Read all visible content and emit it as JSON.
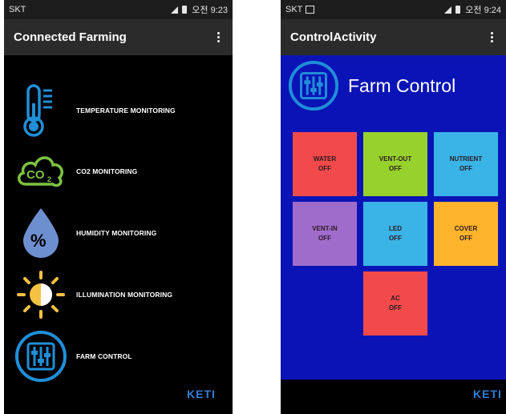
{
  "left": {
    "status": {
      "carrier": "SKT",
      "time": "오전 9:23"
    },
    "appbar_title": "Connected Farming",
    "items": [
      {
        "label": "TEMPERATURE MONITORING",
        "icon": "thermometer-icon"
      },
      {
        "label": "CO2 MONITORING",
        "icon": "co2-cloud-icon"
      },
      {
        "label": "HUMIDITY MONITORING",
        "icon": "humidity-drop-icon"
      },
      {
        "label": "ILLUMINATION MONITORING",
        "icon": "sun-icon"
      },
      {
        "label": "FARM CONTROL",
        "icon": "sliders-icon"
      }
    ],
    "logo": "KETI"
  },
  "right": {
    "status": {
      "carrier": "SKT",
      "time": "오전 9:24"
    },
    "appbar_title": "ControlActivity",
    "header_title": "Farm Control",
    "tiles": [
      {
        "name": "WATER",
        "state": "OFF",
        "color": "#f24a4a"
      },
      {
        "name": "VENT-OUT",
        "state": "OFF",
        "color": "#97d22c"
      },
      {
        "name": "NUTRIENT",
        "state": "OFF",
        "color": "#3ab3e6"
      },
      {
        "name": "VENT-IN",
        "state": "OFF",
        "color": "#a06ccc"
      },
      {
        "name": "LED",
        "state": "OFF",
        "color": "#3ab3e6"
      },
      {
        "name": "COVER",
        "state": "OFF",
        "color": "#ffb32c"
      },
      {
        "name": "AC",
        "state": "OFF",
        "color": "#f24a4a"
      }
    ],
    "logo": "KETI"
  },
  "colors": {
    "accent_blue": "#1f8fd8",
    "control_bg": "#0a14b6",
    "sun": "#f5c242",
    "co2": "#7cc241"
  }
}
